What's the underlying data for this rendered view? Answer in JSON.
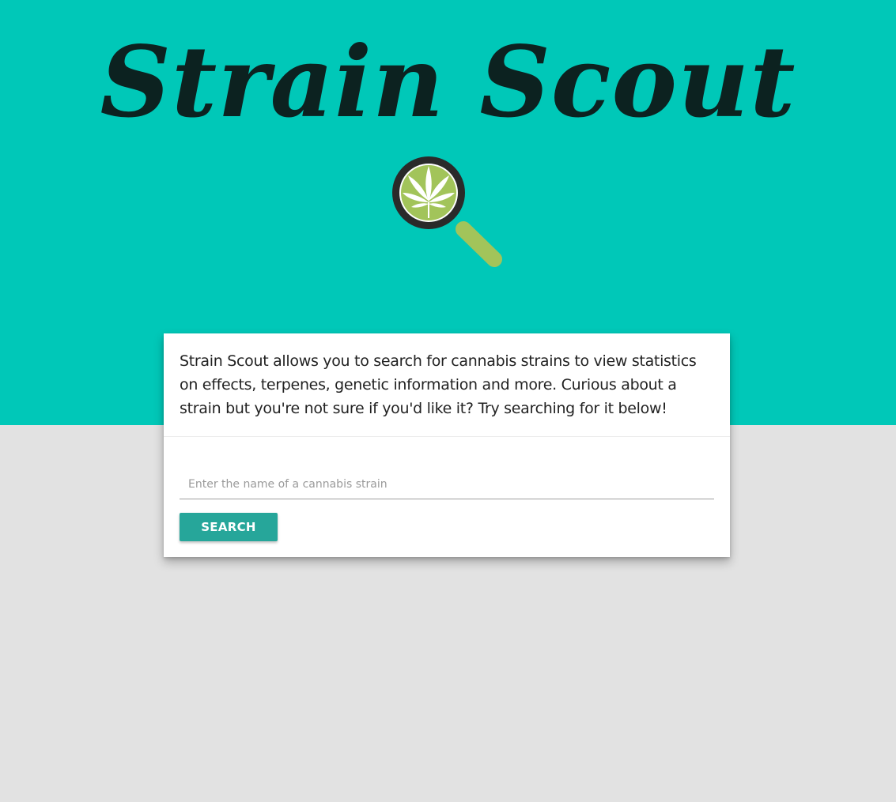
{
  "header": {
    "title": "Strain Scout",
    "logo_icon": "magnifier-cannabis-leaf-icon"
  },
  "card": {
    "description": "Strain Scout allows you to search for cannabis strains to view statistics on effects, terpenes, genetic information and more. Curious about a strain but you're not sure if you'd like it? Try searching for it below!"
  },
  "search": {
    "placeholder": "Enter the name of a cannabis strain",
    "value": "",
    "button_label": "SEARCH"
  },
  "colors": {
    "hero_background": "#00c8b8",
    "page_background": "#e2e2e2",
    "title_text": "#0c2220",
    "button_background": "#26a69a",
    "lens_frame": "#2a2a2a",
    "leaf_circle": "#a2c45a",
    "handle": "#a2c45a"
  }
}
